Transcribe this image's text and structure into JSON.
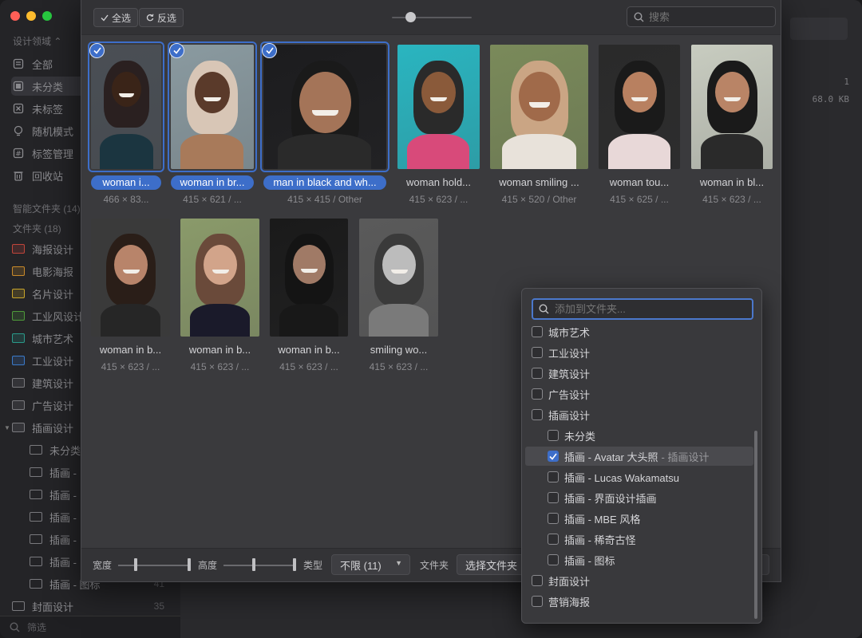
{
  "sidebar": {
    "domain_label": "设计领域",
    "items": [
      {
        "label": "全部",
        "icon": "all-icon"
      },
      {
        "label": "未分类",
        "icon": "uncategorized-icon"
      },
      {
        "label": "未标签",
        "icon": "untagged-icon"
      },
      {
        "label": "随机模式",
        "icon": "random-icon"
      },
      {
        "label": "标签管理",
        "icon": "tag-icon"
      },
      {
        "label": "回收站",
        "icon": "trash-icon"
      }
    ],
    "smart_folders_label": "智能文件夹 (14)",
    "folders_label": "文件夹 (18)",
    "folders": [
      {
        "label": "海报设计",
        "color": "#c0453a"
      },
      {
        "label": "电影海报",
        "color": "#c98a2a"
      },
      {
        "label": "名片设计",
        "color": "#c9a52a"
      },
      {
        "label": "工业风设计",
        "color": "#4e9a3a"
      },
      {
        "label": "城市艺术",
        "color": "#2a9a8a"
      },
      {
        "label": "工业设计",
        "color": "#3a7ac9"
      },
      {
        "label": "建筑设计",
        "color": "#7a7a7e"
      },
      {
        "label": "广告设计",
        "color": "#7a7a7e"
      },
      {
        "label": "插画设计",
        "color": "#7a7a7e"
      }
    ],
    "sub_folders": [
      {
        "label": "未分类",
        "count": ""
      },
      {
        "label": "插画 -",
        "count": ""
      },
      {
        "label": "插画 -",
        "count": ""
      },
      {
        "label": "插画 -",
        "count": ""
      },
      {
        "label": "插画 -",
        "count": ""
      },
      {
        "label": "插画 -",
        "count": ""
      },
      {
        "label": "插画 - 图标",
        "count": "41"
      }
    ],
    "cover_folder": {
      "label": "封面设计",
      "count": "35"
    },
    "filter_placeholder": "筛选"
  },
  "bg_info": {
    "count": "1",
    "size": "68.0 KB"
  },
  "toolbar": {
    "select_all": "全选",
    "invert": "反选",
    "search_placeholder": "搜索"
  },
  "grid": {
    "items": [
      {
        "caption": "woman i...",
        "meta": "466 × 83...",
        "selected": true
      },
      {
        "caption": "woman in br...",
        "meta": "415 × 621 / ...",
        "selected": true
      },
      {
        "caption": "man in black and wh...",
        "meta": "415 × 415 / Other",
        "selected": true
      },
      {
        "caption": "woman hold...",
        "meta": "415 × 623 / ...",
        "selected": false
      },
      {
        "caption": "woman smiling ...",
        "meta": "415 × 520 / Other",
        "selected": false
      },
      {
        "caption": "woman tou...",
        "meta": "415 × 625 / ...",
        "selected": false
      },
      {
        "caption": "woman in bl...",
        "meta": "415 × 623 / ...",
        "selected": false
      },
      {
        "caption": "woman in b...",
        "meta": "415 × 623 / ...",
        "selected": false
      },
      {
        "caption": "woman in b...",
        "meta": "415 × 623 / ...",
        "selected": false
      },
      {
        "caption": "woman in b...",
        "meta": "415 × 623 / ...",
        "selected": false
      },
      {
        "caption": "smiling wo...",
        "meta": "415 × 623 / ...",
        "selected": false
      }
    ]
  },
  "bottom_bar": {
    "width_label": "宽度",
    "height_label": "高度",
    "type_label": "类型",
    "type_value": "不限 (11)",
    "folder_label": "文件夹",
    "folder_value": "选择文件夹"
  },
  "folder_popup": {
    "search_placeholder": "添加到文件夹...",
    "rows": [
      {
        "label": "城市艺术",
        "checked": false,
        "indent": 0,
        "extra": ""
      },
      {
        "label": "工业设计",
        "checked": false,
        "indent": 0,
        "extra": ""
      },
      {
        "label": "建筑设计",
        "checked": false,
        "indent": 0,
        "extra": ""
      },
      {
        "label": "广告设计",
        "checked": false,
        "indent": 0,
        "extra": ""
      },
      {
        "label": "插画设计",
        "checked": false,
        "indent": 0,
        "extra": ""
      },
      {
        "label": "未分类",
        "checked": false,
        "indent": 1,
        "extra": ""
      },
      {
        "label": "插画 - Avatar 大头照",
        "checked": true,
        "indent": 1,
        "extra": "- 插画设计"
      },
      {
        "label": "插画 - Lucas Wakamatsu",
        "checked": false,
        "indent": 1,
        "extra": ""
      },
      {
        "label": "插画 - 界面设计插画",
        "checked": false,
        "indent": 1,
        "extra": ""
      },
      {
        "label": "插画 - MBE 风格",
        "checked": false,
        "indent": 1,
        "extra": ""
      },
      {
        "label": "插画 - 稀奇古怪",
        "checked": false,
        "indent": 1,
        "extra": ""
      },
      {
        "label": "插画 - 图标",
        "checked": false,
        "indent": 1,
        "extra": ""
      },
      {
        "label": "封面设计",
        "checked": false,
        "indent": 0,
        "extra": ""
      },
      {
        "label": "营销海报",
        "checked": false,
        "indent": 0,
        "extra": ""
      }
    ]
  },
  "colors": {
    "accent": "#3d6ec9"
  }
}
